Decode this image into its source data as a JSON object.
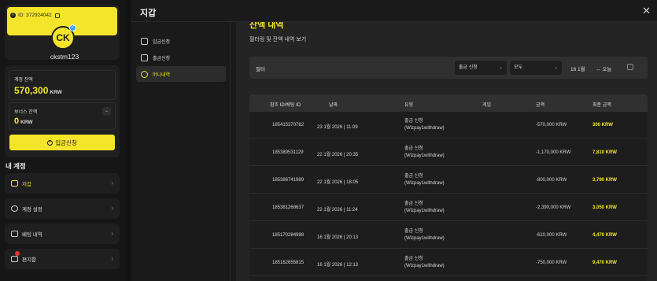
{
  "sidebar": {
    "user_id": "ID: 372924042",
    "avatar_initials": "CK",
    "username": "ckstm123",
    "balance_label": "계정 잔액",
    "balance_value": "570,300",
    "balance_unit": "KRW",
    "bonus_label": "보너스 잔액",
    "bonus_value": "0",
    "bonus_unit": "KRW",
    "deposit_button": "입금신청",
    "section_title": "내 계정",
    "menu": [
      {
        "label": "지갑",
        "icon": "wallet-icon"
      },
      {
        "label": "계정 설정",
        "icon": "user-settings-icon"
      },
      {
        "label": "베팅 내역",
        "icon": "bet-history-icon"
      },
      {
        "label": "편지함",
        "icon": "mail-icon"
      }
    ]
  },
  "modal": {
    "title": "지갑",
    "close": "✕",
    "nav": [
      {
        "label": "입금신청",
        "icon": "deposit-icon"
      },
      {
        "label": "출금신청",
        "icon": "withdraw-icon"
      },
      {
        "label": "머니내역",
        "icon": "money-history-icon"
      }
    ],
    "content_title": "잔액 내역",
    "content_subtitle": "필터링 및 잔액 내역 보기",
    "filter": {
      "label": "필터",
      "type_select": "출금 신청",
      "status_select": "모두",
      "date": "16 1월",
      "today_button": "오늘"
    },
    "table": {
      "headers": [
        "참조 ID/베팅 ID",
        "날짜",
        "유형",
        "게임",
        "금액",
        "최종 금액"
      ],
      "rows": [
        {
          "id": "185415370782",
          "date": "23 1월 2026 | 11:09",
          "type1": "출금 신청",
          "type2": "(Wizpay1withdraw)",
          "amount": "-570,000 KRW",
          "final": "300 KRW"
        },
        {
          "id": "185389531129",
          "date": "22 1월 2026 | 20:35",
          "type1": "출금 신청",
          "type2": "(Wizpay1withdraw)",
          "amount": "-1,170,000 KRW",
          "final": "7,810 KRW"
        },
        {
          "id": "185386741989",
          "date": "22 1월 2026 | 18:05",
          "type1": "출금 신청",
          "type2": "(Wizpay1withdraw)",
          "amount": "-800,000 KRW",
          "final": "3,790 KRW"
        },
        {
          "id": "185381268637",
          "date": "22 1월 2026 | 11:24",
          "type1": "출금 신청",
          "type2": "(Wizpay1withdraw)",
          "amount": "-2,390,000 KRW",
          "final": "3,050 KRW"
        },
        {
          "id": "185170284988",
          "date": "16 1월 2026 | 20:13",
          "type1": "출금 신청",
          "type2": "(Wizpay1withdraw)",
          "amount": "-610,000 KRW",
          "final": "4,470 KRW"
        },
        {
          "id": "185162655815",
          "date": "16 1월 2026 | 12:13",
          "type1": "출금 신청",
          "type2": "(Wizpay1withdraw)",
          "amount": "-750,000 KRW",
          "final": "9,470 KRW"
        }
      ]
    }
  },
  "colors": {
    "accent": "#f5e52a",
    "background": "#121212",
    "panel": "#1f1f1f"
  }
}
